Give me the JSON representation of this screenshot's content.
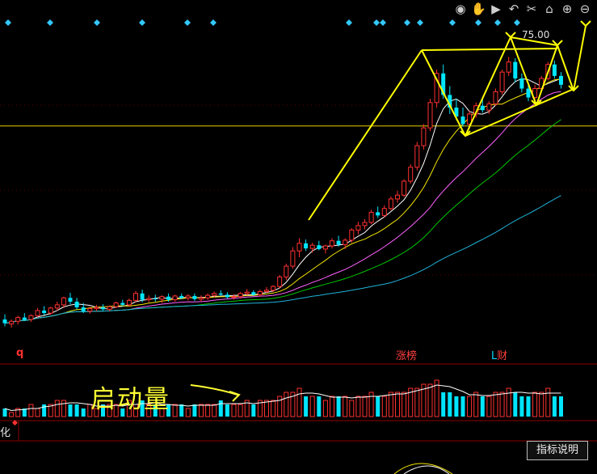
{
  "toolbar": {
    "icons": [
      "eye-icon",
      "hand-icon",
      "play-icon",
      "undo-icon",
      "scissors-icon",
      "lock-icon",
      "zoom-in-icon",
      "zoom-out-icon"
    ]
  },
  "labels": {
    "price_level": "75.00",
    "marker_q": "q",
    "marker_zhangbang": "涨榜",
    "marker_l": "L",
    "marker_cai": "财",
    "annotation": "启动量",
    "panel_tab": "化",
    "help_button": "指标说明"
  },
  "colors": {
    "background": "#000000",
    "up_candle": "#ff3030",
    "down_candle": "#00e5ff",
    "ma_white": "#ffffff",
    "ma_yellow": "#f5e600",
    "ma_magenta": "#ff60ff",
    "ma_green": "#00c800",
    "ma_cyan": "#1fb3d9",
    "annotation": "#ffff33",
    "diamond": "#33c8ff"
  },
  "chart_data": {
    "type": "candlestick",
    "y_axis": {
      "min": 30,
      "max": 80
    },
    "horizontal_reference": 63.7,
    "candles": [
      {
        "o": 33.2,
        "h": 34.0,
        "l": 32.1,
        "c": 32.6
      },
      {
        "o": 32.5,
        "h": 33.2,
        "l": 31.9,
        "c": 32.9
      },
      {
        "o": 32.9,
        "h": 33.8,
        "l": 32.4,
        "c": 33.5
      },
      {
        "o": 33.5,
        "h": 34.2,
        "l": 33.0,
        "c": 33.1
      },
      {
        "o": 33.2,
        "h": 34.0,
        "l": 32.8,
        "c": 33.8
      },
      {
        "o": 33.8,
        "h": 35.0,
        "l": 33.5,
        "c": 34.6
      },
      {
        "o": 34.6,
        "h": 35.3,
        "l": 33.9,
        "c": 34.2
      },
      {
        "o": 34.2,
        "h": 35.2,
        "l": 33.9,
        "c": 35.0
      },
      {
        "o": 35.0,
        "h": 36.0,
        "l": 34.6,
        "c": 35.5
      },
      {
        "o": 35.5,
        "h": 36.8,
        "l": 35.0,
        "c": 36.6
      },
      {
        "o": 36.6,
        "h": 37.4,
        "l": 35.6,
        "c": 36.0
      },
      {
        "o": 36.0,
        "h": 36.6,
        "l": 34.8,
        "c": 35.1
      },
      {
        "o": 35.1,
        "h": 35.8,
        "l": 34.2,
        "c": 34.5
      },
      {
        "o": 34.5,
        "h": 35.2,
        "l": 34.1,
        "c": 34.9
      },
      {
        "o": 34.9,
        "h": 35.5,
        "l": 34.5,
        "c": 35.1
      },
      {
        "o": 35.1,
        "h": 35.6,
        "l": 34.6,
        "c": 34.8
      },
      {
        "o": 34.8,
        "h": 35.4,
        "l": 34.5,
        "c": 35.2
      },
      {
        "o": 35.2,
        "h": 36.0,
        "l": 35.0,
        "c": 35.8
      },
      {
        "o": 35.8,
        "h": 36.3,
        "l": 35.3,
        "c": 35.5
      },
      {
        "o": 35.5,
        "h": 36.5,
        "l": 35.2,
        "c": 36.2
      },
      {
        "o": 36.2,
        "h": 37.7,
        "l": 35.9,
        "c": 37.3
      },
      {
        "o": 37.3,
        "h": 37.9,
        "l": 35.9,
        "c": 36.3
      },
      {
        "o": 36.3,
        "h": 37.0,
        "l": 35.9,
        "c": 36.5
      },
      {
        "o": 36.5,
        "h": 37.1,
        "l": 36.0,
        "c": 36.4
      },
      {
        "o": 36.4,
        "h": 37.0,
        "l": 35.8,
        "c": 36.8
      },
      {
        "o": 36.8,
        "h": 37.3,
        "l": 36.0,
        "c": 36.3
      },
      {
        "o": 36.3,
        "h": 37.1,
        "l": 36.0,
        "c": 36.9
      },
      {
        "o": 36.9,
        "h": 37.3,
        "l": 36.4,
        "c": 36.6
      },
      {
        "o": 36.6,
        "h": 37.2,
        "l": 36.2,
        "c": 36.9
      },
      {
        "o": 36.9,
        "h": 37.3,
        "l": 36.1,
        "c": 36.4
      },
      {
        "o": 36.4,
        "h": 37.0,
        "l": 36.0,
        "c": 36.6
      },
      {
        "o": 36.6,
        "h": 37.3,
        "l": 36.3,
        "c": 37.0
      },
      {
        "o": 37.0,
        "h": 37.6,
        "l": 36.7,
        "c": 37.3
      },
      {
        "o": 37.3,
        "h": 37.8,
        "l": 36.9,
        "c": 37.1
      },
      {
        "o": 37.1,
        "h": 37.5,
        "l": 36.5,
        "c": 36.7
      },
      {
        "o": 36.7,
        "h": 37.2,
        "l": 36.3,
        "c": 36.8
      },
      {
        "o": 36.8,
        "h": 37.5,
        "l": 36.5,
        "c": 37.3
      },
      {
        "o": 37.3,
        "h": 38.0,
        "l": 37.0,
        "c": 37.5
      },
      {
        "o": 37.5,
        "h": 37.8,
        "l": 36.9,
        "c": 37.1
      },
      {
        "o": 37.1,
        "h": 37.9,
        "l": 36.8,
        "c": 37.6
      },
      {
        "o": 37.6,
        "h": 38.3,
        "l": 37.4,
        "c": 37.8
      },
      {
        "o": 37.8,
        "h": 38.6,
        "l": 37.5,
        "c": 38.4
      },
      {
        "o": 38.4,
        "h": 40.2,
        "l": 38.1,
        "c": 39.9
      },
      {
        "o": 39.9,
        "h": 42.0,
        "l": 39.4,
        "c": 41.6
      },
      {
        "o": 41.6,
        "h": 44.6,
        "l": 41.2,
        "c": 44.0
      },
      {
        "o": 44.0,
        "h": 46.0,
        "l": 43.0,
        "c": 45.2
      },
      {
        "o": 45.2,
        "h": 45.8,
        "l": 44.0,
        "c": 44.4
      },
      {
        "o": 44.4,
        "h": 45.3,
        "l": 43.7,
        "c": 44.9
      },
      {
        "o": 44.9,
        "h": 45.6,
        "l": 44.1,
        "c": 44.3
      },
      {
        "o": 44.3,
        "h": 45.0,
        "l": 43.6,
        "c": 44.8
      },
      {
        "o": 44.8,
        "h": 46.0,
        "l": 44.4,
        "c": 45.6
      },
      {
        "o": 45.6,
        "h": 46.4,
        "l": 44.7,
        "c": 45.0
      },
      {
        "o": 45.0,
        "h": 46.0,
        "l": 44.3,
        "c": 45.7
      },
      {
        "o": 45.7,
        "h": 47.6,
        "l": 45.3,
        "c": 47.3
      },
      {
        "o": 47.3,
        "h": 48.6,
        "l": 46.6,
        "c": 48.0
      },
      {
        "o": 48.0,
        "h": 49.0,
        "l": 47.4,
        "c": 48.5
      },
      {
        "o": 48.5,
        "h": 50.5,
        "l": 48.2,
        "c": 50.1
      },
      {
        "o": 50.1,
        "h": 51.0,
        "l": 49.2,
        "c": 49.6
      },
      {
        "o": 49.6,
        "h": 51.2,
        "l": 49.3,
        "c": 50.7
      },
      {
        "o": 50.7,
        "h": 52.6,
        "l": 50.4,
        "c": 52.2
      },
      {
        "o": 52.2,
        "h": 53.5,
        "l": 51.6,
        "c": 52.8
      },
      {
        "o": 52.8,
        "h": 55.3,
        "l": 52.5,
        "c": 55.0
      },
      {
        "o": 55.0,
        "h": 57.7,
        "l": 54.6,
        "c": 57.2
      },
      {
        "o": 57.2,
        "h": 61.2,
        "l": 56.7,
        "c": 60.6
      },
      {
        "o": 60.6,
        "h": 64.0,
        "l": 60.0,
        "c": 63.4
      },
      {
        "o": 63.4,
        "h": 68.0,
        "l": 62.9,
        "c": 67.4
      },
      {
        "o": 67.4,
        "h": 72.6,
        "l": 66.6,
        "c": 72.0
      },
      {
        "o": 72.0,
        "h": 73.4,
        "l": 68.0,
        "c": 68.6
      },
      {
        "o": 68.6,
        "h": 70.0,
        "l": 65.6,
        "c": 66.6
      },
      {
        "o": 66.6,
        "h": 68.0,
        "l": 64.6,
        "c": 65.2
      },
      {
        "o": 65.2,
        "h": 66.6,
        "l": 63.6,
        "c": 64.0
      },
      {
        "o": 64.0,
        "h": 66.1,
        "l": 63.2,
        "c": 65.6
      },
      {
        "o": 65.6,
        "h": 67.4,
        "l": 65.0,
        "c": 66.9
      },
      {
        "o": 66.9,
        "h": 68.0,
        "l": 65.8,
        "c": 66.2
      },
      {
        "o": 66.2,
        "h": 67.6,
        "l": 65.6,
        "c": 67.2
      },
      {
        "o": 67.2,
        "h": 69.6,
        "l": 66.9,
        "c": 69.1
      },
      {
        "o": 69.1,
        "h": 72.6,
        "l": 68.6,
        "c": 72.2
      },
      {
        "o": 72.2,
        "h": 74.6,
        "l": 71.6,
        "c": 73.8
      },
      {
        "o": 73.8,
        "h": 74.4,
        "l": 70.6,
        "c": 71.2
      },
      {
        "o": 71.2,
        "h": 72.0,
        "l": 69.0,
        "c": 69.6
      },
      {
        "o": 69.6,
        "h": 70.6,
        "l": 67.6,
        "c": 68.2
      },
      {
        "o": 68.2,
        "h": 70.2,
        "l": 67.6,
        "c": 69.6
      },
      {
        "o": 69.6,
        "h": 71.6,
        "l": 69.1,
        "c": 71.2
      },
      {
        "o": 71.2,
        "h": 73.8,
        "l": 70.9,
        "c": 73.4
      },
      {
        "o": 73.4,
        "h": 74.0,
        "l": 71.2,
        "c": 71.6
      },
      {
        "o": 71.6,
        "h": 72.2,
        "l": 69.6,
        "c": 70.2
      }
    ],
    "volume": [
      2,
      1,
      2,
      2,
      3,
      2,
      3,
      3,
      4,
      4,
      3,
      3,
      2,
      3,
      2,
      3,
      3,
      3,
      2,
      4,
      3,
      4,
      3,
      3,
      2,
      3,
      3,
      3,
      2,
      3,
      3,
      3,
      3,
      4,
      3,
      3,
      3,
      4,
      3,
      4,
      4,
      4,
      5,
      6,
      6,
      7,
      5,
      5,
      5,
      4,
      5,
      5,
      5,
      4,
      5,
      5,
      6,
      5,
      5,
      6,
      6,
      6,
      7,
      7,
      8,
      8,
      9,
      6,
      6,
      5,
      5,
      5,
      6,
      5,
      5,
      6,
      6,
      7,
      6,
      5,
      5,
      6,
      6,
      7,
      5,
      5
    ],
    "ma_series": [
      {
        "key": "ma_white",
        "n": 5
      },
      {
        "key": "ma_yellow",
        "n": 10
      },
      {
        "key": "ma_magenta",
        "n": 20
      },
      {
        "key": "ma_green",
        "n": 30
      },
      {
        "key": "ma_cyan",
        "n": 60
      }
    ]
  }
}
